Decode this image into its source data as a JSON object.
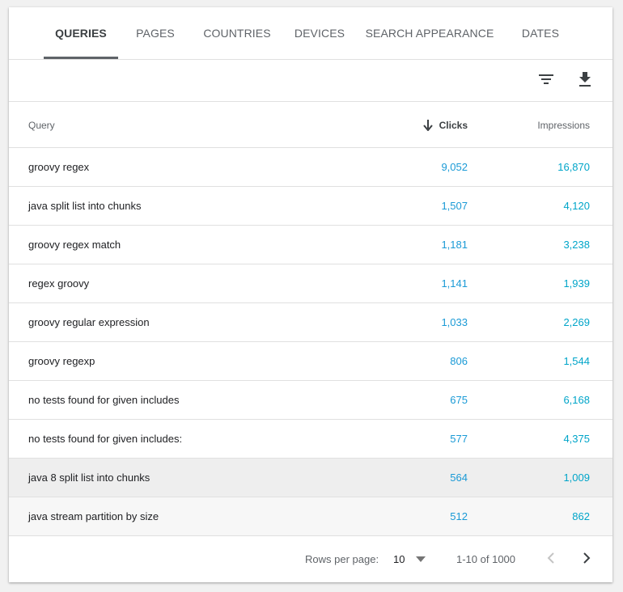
{
  "tabs": [
    {
      "label": "QUERIES",
      "active": true
    },
    {
      "label": "PAGES",
      "active": false
    },
    {
      "label": "COUNTRIES",
      "active": false
    },
    {
      "label": "DEVICES",
      "active": false
    },
    {
      "label": "SEARCH APPEARANCE",
      "active": false
    },
    {
      "label": "DATES",
      "active": false
    }
  ],
  "toolbar": {
    "filter_icon": "filter-list-icon",
    "download_icon": "download-icon"
  },
  "table": {
    "columns": {
      "query": "Query",
      "clicks": "Clicks",
      "impressions": "Impressions"
    },
    "sort": {
      "column": "clicks",
      "direction": "descending",
      "icon": "arrow-down-icon"
    },
    "rows": [
      {
        "query": "groovy regex",
        "clicks": "9,052",
        "impressions": "16,870"
      },
      {
        "query": "java split list into chunks",
        "clicks": "1,507",
        "impressions": "4,120"
      },
      {
        "query": "groovy regex match",
        "clicks": "1,181",
        "impressions": "3,238"
      },
      {
        "query": "regex groovy",
        "clicks": "1,141",
        "impressions": "1,939"
      },
      {
        "query": "groovy regular expression",
        "clicks": "1,033",
        "impressions": "2,269"
      },
      {
        "query": "groovy regexp",
        "clicks": "806",
        "impressions": "1,544"
      },
      {
        "query": "no tests found for given includes",
        "clicks": "675",
        "impressions": "6,168"
      },
      {
        "query": "no tests found for given includes:",
        "clicks": "577",
        "impressions": "4,375"
      },
      {
        "query": "java 8 split list into chunks",
        "clicks": "564",
        "impressions": "1,009"
      },
      {
        "query": "java stream partition by size",
        "clicks": "512",
        "impressions": "862"
      }
    ]
  },
  "pagination": {
    "rows_per_page_label": "Rows per page:",
    "rows_per_page_value": "10",
    "range_label": "1-10 of 1000"
  },
  "colors": {
    "clicks": "#1a9ad6",
    "impressions": "#00a5c9",
    "tab_indicator": "#5f6368"
  }
}
